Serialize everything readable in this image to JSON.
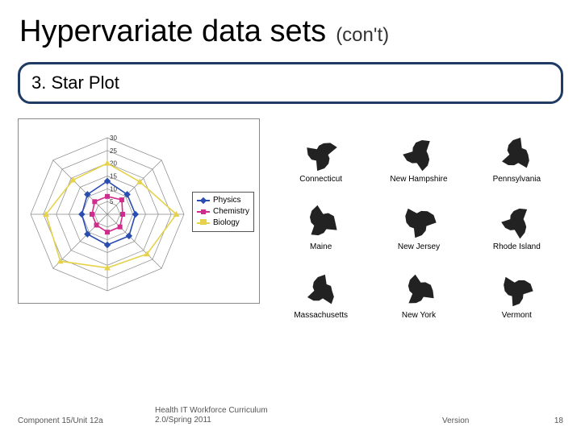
{
  "title": {
    "main": "Hypervariate data sets",
    "suffix": "(con't)"
  },
  "section": {
    "label": "3. Star Plot"
  },
  "chart_data": {
    "type": "radar",
    "title": "",
    "axes_count": 8,
    "ticks": [
      5,
      10,
      15,
      20,
      25,
      30
    ],
    "rlim": [
      0,
      30
    ],
    "series": [
      {
        "name": "Physics",
        "color": "#2a4db0",
        "marker": "diamond",
        "values": [
          13,
          11,
          11,
          12,
          12,
          11,
          10,
          11
        ]
      },
      {
        "name": "Chemistry",
        "color": "#d02c8e",
        "marker": "square",
        "values": [
          7,
          8,
          6,
          7,
          7,
          6,
          6,
          7
        ]
      },
      {
        "name": "Biology",
        "color": "#e6d24a",
        "marker": "triangle",
        "values": [
          20,
          18,
          27,
          22,
          21,
          26,
          24,
          19
        ]
      }
    ],
    "legend_position": "right"
  },
  "small_multiples": [
    {
      "label": "Connecticut"
    },
    {
      "label": "New Hampshire"
    },
    {
      "label": "Pennsylvania"
    },
    {
      "label": "Maine"
    },
    {
      "label": "New Jersey"
    },
    {
      "label": "Rhode Island"
    },
    {
      "label": "Massachusetts"
    },
    {
      "label": "New York"
    },
    {
      "label": "Vermont"
    }
  ],
  "footer": {
    "left": "Component 15/Unit 12a",
    "center_line1": "Health IT Workforce Curriculum",
    "center_line2": "2.0/Spring 2011",
    "version_label": "Version",
    "page": "18"
  }
}
